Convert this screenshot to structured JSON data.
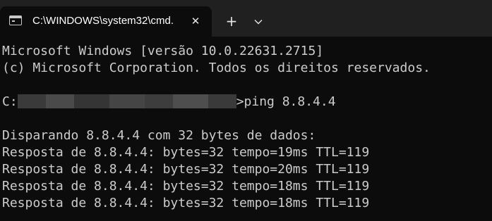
{
  "tab": {
    "title": "C:\\WINDOWS\\system32\\cmd.",
    "close_glyph": "✕",
    "icon": "cmd-icon"
  },
  "toolbar": {
    "new_tab_glyph": "+",
    "dropdown_icon": "chevron-down-icon"
  },
  "terminal": {
    "header_line1": "Microsoft Windows [versão 10.0.22631.2715]",
    "header_line2": "(c) Microsoft Corporation. Todos os direitos reservados.",
    "prompt_drive": "C:",
    "prompt_command": ">ping 8.8.4.4",
    "ping_header": "Disparando 8.8.4.4 com 32 bytes de dados:",
    "replies": [
      "Resposta de 8.8.4.4: bytes=32 tempo=19ms TTL=119",
      "Resposta de 8.8.4.4: bytes=32 tempo=20ms TTL=119",
      "Resposta de 8.8.4.4: bytes=32 tempo=18ms TTL=119",
      "Resposta de 8.8.4.4: bytes=32 tempo=18ms TTL=119"
    ]
  },
  "colors": {
    "titlebar_bg": "#202020",
    "terminal_bg": "#0c0c0c",
    "terminal_text": "#cccccc"
  }
}
